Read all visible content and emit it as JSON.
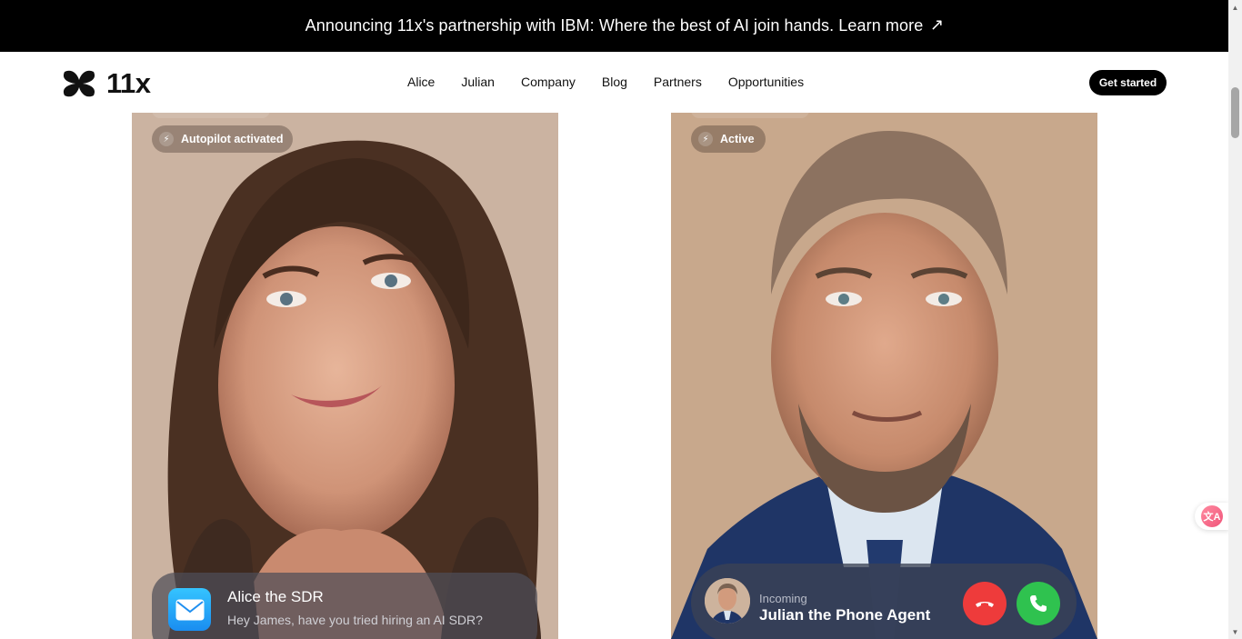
{
  "announcement": {
    "text": "Announcing 11x's partnership with IBM: Where the best of AI join hands. Learn more",
    "arrow": "↗"
  },
  "brand": {
    "name": "11x"
  },
  "nav": {
    "links": [
      "Alice",
      "Julian",
      "Company",
      "Blog",
      "Partners",
      "Opportunities"
    ],
    "cta": "Get started"
  },
  "cards": {
    "alice": {
      "badge": "Autopilot activated",
      "message_title": "Alice the SDR",
      "message_preview": "Hey James, have you tried hiring an AI SDR?",
      "icon": "mail-icon"
    },
    "julian": {
      "badge": "Active",
      "call_label": "Incoming",
      "call_name": "Julian the Phone Agent",
      "icons": [
        "decline-call-icon",
        "accept-call-icon"
      ]
    }
  },
  "colors": {
    "announcement_bg": "#000000",
    "cta_bg": "#000000",
    "decline": "#ee3b3b",
    "accept": "#2fc24f"
  }
}
